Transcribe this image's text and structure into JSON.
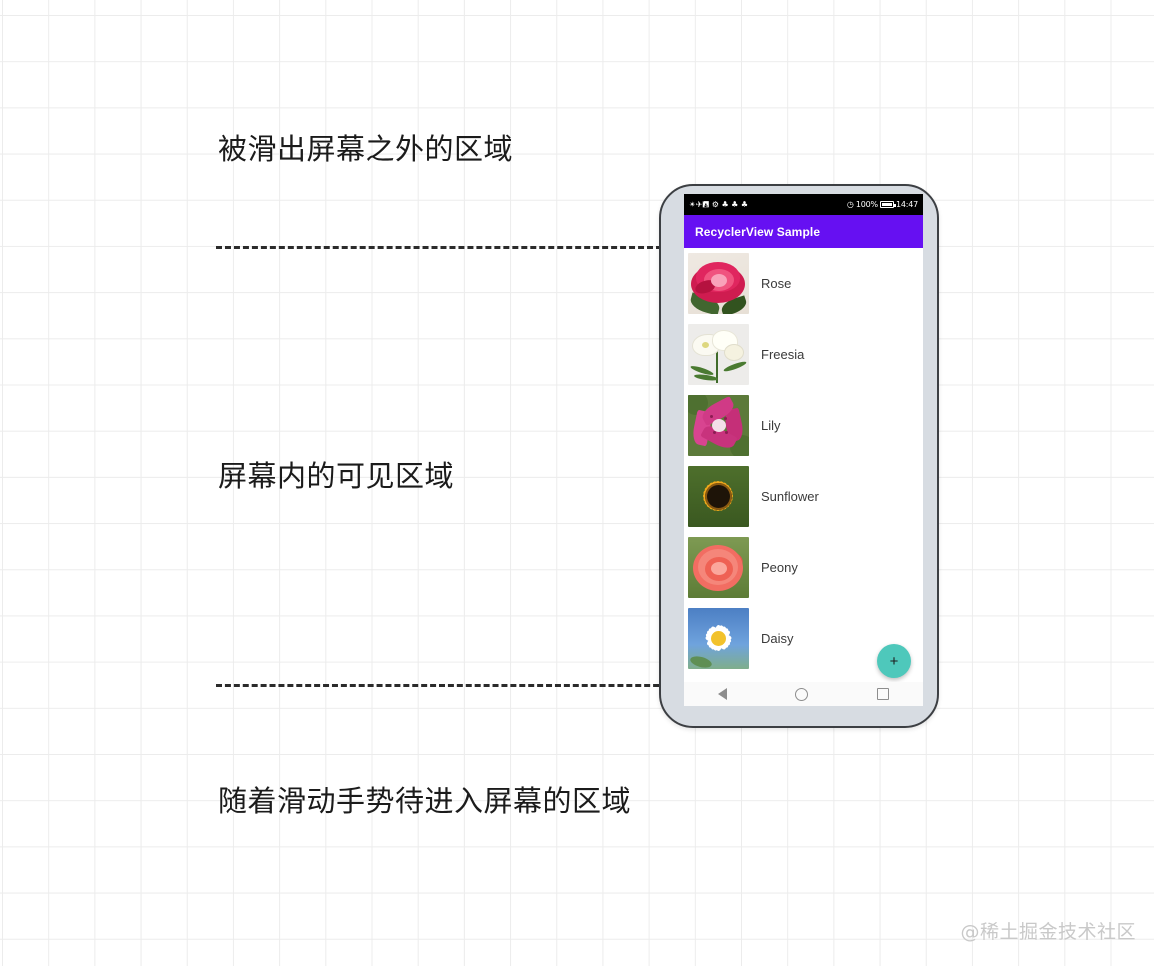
{
  "annotations": {
    "above_screen": "被滑出屏幕之外的区域",
    "visible_screen": "屏幕内的可见区域",
    "below_screen": "随着滑动手势待进入屏幕的区域"
  },
  "watermark": "@稀土掘金技术社区",
  "phone": {
    "status_bar": {
      "left_glyphs": "✴✈🖪 ⚙ ♣ ♣ ♣",
      "signal_text": "100%",
      "time": "14:47",
      "battery_label": "battery-full",
      "background": "#000000"
    },
    "app_bar": {
      "title": "RecyclerView Sample",
      "background": "#6610f2",
      "text_color": "#ffffff"
    },
    "list": {
      "items": [
        {
          "label": "Rose",
          "thumb": "rose-thumb"
        },
        {
          "label": "Freesia",
          "thumb": "freesia-thumb"
        },
        {
          "label": "Lily",
          "thumb": "lily-thumb"
        },
        {
          "label": "Sunflower",
          "thumb": "sunflower-thumb"
        },
        {
          "label": "Peony",
          "thumb": "peony-thumb"
        },
        {
          "label": "Daisy",
          "thumb": "daisy-thumb"
        }
      ]
    },
    "fab": {
      "label": "+",
      "color": "#4ec8bb"
    },
    "nav_bar": {
      "back": "back-icon",
      "home": "home-icon",
      "recents": "recents-icon"
    },
    "body_color": "#d7dce2",
    "outline_color": "#3c3f43"
  },
  "divider_color": "#2b2b2b",
  "grid_color": "#ececec"
}
